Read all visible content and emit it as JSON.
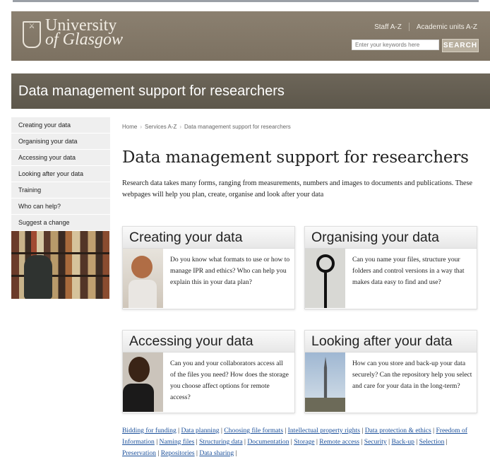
{
  "header": {
    "university_line1": "University",
    "university_line2": "of Glasgow",
    "crest_symbol": "⚔",
    "links": [
      "Staff A-Z",
      "Academic units A-Z"
    ],
    "search_placeholder": "Enter your keywords here",
    "search_button": "SEARCH"
  },
  "banner": {
    "title": "Data management support for researchers"
  },
  "sidebar": {
    "items": [
      {
        "label": "Creating your data"
      },
      {
        "label": "Organising your data"
      },
      {
        "label": "Accessing your data"
      },
      {
        "label": "Looking after your data"
      },
      {
        "label": "Training"
      },
      {
        "label": "Who can help?"
      },
      {
        "label": "Suggest a change"
      }
    ]
  },
  "breadcrumb": {
    "items": [
      "Home",
      "Services A-Z",
      "Data management support for researchers"
    ],
    "sep": "›"
  },
  "main": {
    "title": "Data management support for researchers",
    "intro": "Research data takes many forms, ranging from measurements, numbers and images to documents and publications. These webpages will help you plan, create, organise and look after your data",
    "cards": [
      {
        "title": "Creating your data",
        "text": "Do you know what formats to use or how to manage IPR and ethics? Who can help you explain this in your data plan?"
      },
      {
        "title": "Organising your data",
        "text": "Can you name your files, structure your folders and control versions in a way that makes data easy to find and use?"
      },
      {
        "title": "Accessing your data",
        "text": "Can you and your collaborators access all of the files you need? How does the storage you choose affect options for remote access?"
      },
      {
        "title": "Looking after your data",
        "text": "How can you store and back-up your data securely? Can the repository help you select and care for your data in the long-term?"
      }
    ]
  },
  "footer_links": [
    "Bidding for funding",
    "Data planning",
    "Choosing file formats",
    "Intellectual property rights",
    "Data protection & ethics",
    "Freedom of Information",
    "Naming files",
    "Structuring data",
    "Documentation",
    "Storage",
    "Remote access",
    "Security",
    "Back-up",
    "Selection",
    "Preservation",
    "Repositories",
    "Data sharing"
  ],
  "footer_sep": " | "
}
